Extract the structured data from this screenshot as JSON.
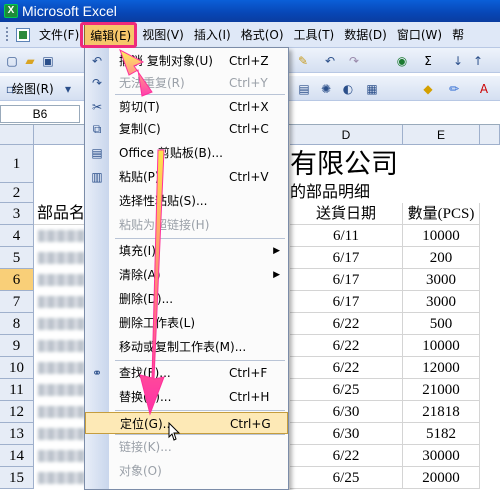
{
  "window": {
    "title": "Microsoft Excel"
  },
  "menubar": {
    "items": [
      "文件(F)",
      "编辑(E)",
      "视图(V)",
      "插入(I)",
      "格式(O)",
      "工具(T)",
      "数据(D)",
      "窗口(W)",
      "帮"
    ]
  },
  "toolbar2": {
    "draw_label": "绘图(R)"
  },
  "namebox": {
    "value": "B6"
  },
  "sheet": {
    "columns": [
      "D",
      "E"
    ],
    "rows": [
      "1",
      "2",
      "3",
      "4",
      "5",
      "6",
      "7",
      "8",
      "9",
      "10",
      "11",
      "12",
      "13",
      "14",
      "15"
    ],
    "title_fragment": "有限公司",
    "subtitle_fragment": "的部品明细",
    "header_a": "部品名",
    "header_d": "送貨日期",
    "header_e": "數量(PCS)",
    "dates": [
      "6/11",
      "6/17",
      "6/17",
      "6/17",
      "6/22",
      "6/22",
      "6/22",
      "6/25",
      "6/30",
      "6/30",
      "6/22",
      "6/25"
    ],
    "quantities": [
      "10000",
      "200",
      "3000",
      "3000",
      "500",
      "10000",
      "12000",
      "21000",
      "21818",
      "5182",
      "30000",
      "20000"
    ]
  },
  "edit_menu": {
    "items": [
      {
        "label": "撤消 复制对象(U)",
        "shortcut": "Ctrl+Z",
        "icon": "undo-icon",
        "disabled": false
      },
      {
        "label": "无法重复(R)",
        "shortcut": "Ctrl+Y",
        "icon": "redo-icon",
        "disabled": true
      },
      {
        "label": "剪切(T)",
        "shortcut": "Ctrl+X",
        "icon": "scissors-icon",
        "disabled": false
      },
      {
        "label": "复制(C)",
        "shortcut": "Ctrl+C",
        "icon": "copy-icon",
        "disabled": false
      },
      {
        "label": "Office 剪贴板(B)...",
        "shortcut": "",
        "icon": "clipboard-icon",
        "disabled": false
      },
      {
        "label": "粘贴(P)",
        "shortcut": "Ctrl+V",
        "icon": "paste-icon",
        "disabled": false
      },
      {
        "label": "选择性粘贴(S)...",
        "shortcut": "",
        "icon": "",
        "disabled": false
      },
      {
        "label": "粘贴为超链接(H)",
        "shortcut": "",
        "icon": "",
        "disabled": true
      },
      {
        "label": "填充(I)",
        "shortcut": "",
        "icon": "",
        "disabled": false,
        "submenu": true
      },
      {
        "label": "清除(A)",
        "shortcut": "",
        "icon": "",
        "disabled": false,
        "submenu": true
      },
      {
        "label": "删除(D)...",
        "shortcut": "",
        "icon": "",
        "disabled": false
      },
      {
        "label": "删除工作表(L)",
        "shortcut": "",
        "icon": "",
        "disabled": false
      },
      {
        "label": "移动或复制工作表(M)...",
        "shortcut": "",
        "icon": "",
        "disabled": false
      },
      {
        "label": "查找(F)...",
        "shortcut": "Ctrl+F",
        "icon": "binoculars-icon",
        "disabled": false
      },
      {
        "label": "替换(E)...",
        "shortcut": "Ctrl+H",
        "icon": "",
        "disabled": false
      },
      {
        "label": "定位(G)...",
        "shortcut": "Ctrl+G",
        "icon": "",
        "disabled": false,
        "hover": true
      },
      {
        "label": "链接(K)...",
        "shortcut": "",
        "icon": "",
        "disabled": true
      },
      {
        "label": "对象(O)",
        "shortcut": "",
        "icon": "",
        "disabled": true
      }
    ]
  },
  "colors": {
    "menu_highlight": "#f6c66a",
    "annotation_box": "#ee2a7b",
    "arrow_gradient_start": "#ffee00",
    "arrow_gradient_end": "#ff2fa8"
  }
}
